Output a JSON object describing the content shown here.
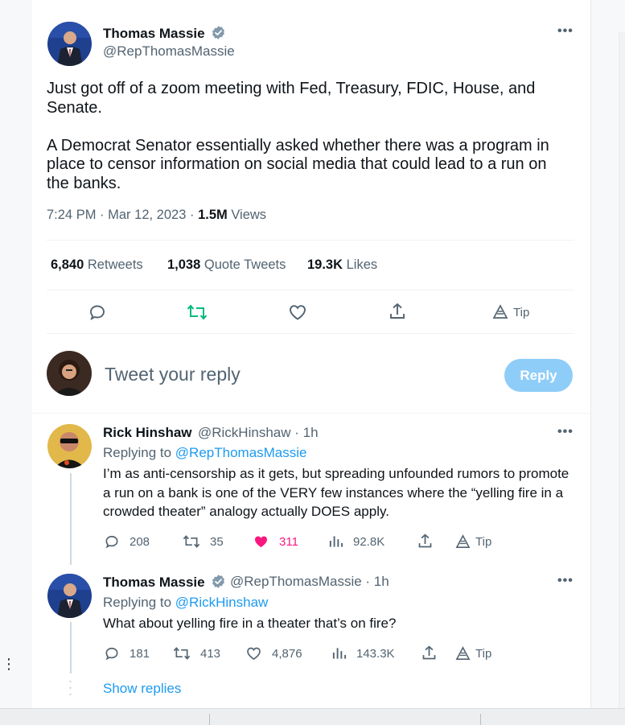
{
  "main_tweet": {
    "author_name": "Thomas Massie",
    "author_handle": "@RepThomasMassie",
    "text_p1": "Just got off of a zoom meeting with Fed, Treasury, FDIC, House, and Senate.",
    "text_p2": "A Democrat Senator essentially asked whether there was a program in place to censor information on social media that could lead to a run on the banks.",
    "time": "7:24 PM",
    "date": "Mar 12, 2023",
    "views_count": "1.5M",
    "views_label": "Views",
    "retweets_count": "6,840",
    "retweets_label": "Retweets",
    "quotes_count": "1,038",
    "quotes_label": "Quote Tweets",
    "likes_count": "19.3K",
    "likes_label": "Likes",
    "tip_label": "Tip"
  },
  "compose": {
    "placeholder": "Tweet your reply",
    "reply_button": "Reply"
  },
  "replies": [
    {
      "name": "Rick Hinshaw",
      "handle_time": "@RickHinshaw · 1h",
      "replying_prefix": "Replying to",
      "replying_to": "@RepThomasMassie",
      "text": "I’m as anti-censorship as it gets, but spreading unfounded rumors to promote a run on a bank is one of the VERY few instances where the “yelling fire in a crowded theater” analogy actually DOES apply.",
      "replies": "208",
      "retweets": "35",
      "likes": "311",
      "views": "92.8K",
      "tip": "Tip"
    },
    {
      "name": "Thomas Massie",
      "handle_time": "@RepThomasMassie · 1h",
      "replying_prefix": "Replying to",
      "replying_to": "@RickHinshaw",
      "text": "What about yelling fire in a theater that’s on fire?",
      "replies": "181",
      "retweets": "413",
      "likes": "4,876",
      "views": "143.3K",
      "tip": "Tip"
    }
  ],
  "show_replies": "Show replies",
  "colors": {
    "accent": "#1d9bf0",
    "retweet": "#00ba7c",
    "like": "#f91880",
    "muted": "#536471",
    "reply_button_disabled": "#8ecdf8"
  }
}
